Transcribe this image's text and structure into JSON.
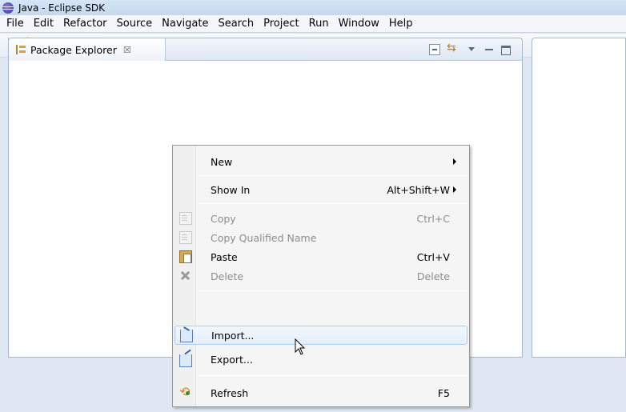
{
  "window": {
    "title": "Java - Eclipse SDK",
    "icon": "eclipse-icon"
  },
  "menubar": {
    "items": [
      "File",
      "Edit",
      "Refactor",
      "Source",
      "Navigate",
      "Search",
      "Project",
      "Run",
      "Window",
      "Help"
    ]
  },
  "toolbar": {
    "icons": [
      "new-wizard-icon",
      "save-icon",
      "save-all-icon",
      "print-icon",
      "download-icon",
      "build-icon",
      "task-check-icon",
      "new-java-project-icon",
      "new-junit-icon",
      "new-file-icon",
      "debug-icon",
      "run-icon",
      "external-tools-icon",
      "skip-breakpoints-icon",
      "new-package-icon",
      "new-class-icon",
      "open-type-icon"
    ]
  },
  "view": {
    "tab_label": "Package Explorer",
    "tab_close": "☒",
    "actions": [
      "collapse-all-icon",
      "link-with-editor-icon",
      "view-menu-icon",
      "minimize-icon",
      "maximize-icon"
    ]
  },
  "context_menu": {
    "items": [
      {
        "label": "New",
        "shortcut": "",
        "submenu": true,
        "enabled": true,
        "icon": ""
      },
      {
        "label": "Show In",
        "shortcut": "Alt+Shift+W",
        "submenu": true,
        "enabled": true,
        "icon": ""
      },
      {
        "label": "Copy",
        "shortcut": "Ctrl+C",
        "submenu": false,
        "enabled": false,
        "icon": "copy-icon"
      },
      {
        "label": "Copy Qualified Name",
        "shortcut": "",
        "submenu": false,
        "enabled": false,
        "icon": "copy-qualified-name-icon"
      },
      {
        "label": "Paste",
        "shortcut": "Ctrl+V",
        "submenu": false,
        "enabled": true,
        "icon": "paste-icon"
      },
      {
        "label": "Delete",
        "shortcut": "Delete",
        "submenu": false,
        "enabled": false,
        "icon": "delete-icon"
      },
      {
        "label": "Import...",
        "shortcut": "",
        "submenu": false,
        "enabled": true,
        "icon": "import-icon",
        "highlighted": true
      },
      {
        "label": "Export...",
        "shortcut": "",
        "submenu": false,
        "enabled": true,
        "icon": "export-icon"
      },
      {
        "label": "Refresh",
        "shortcut": "F5",
        "submenu": false,
        "enabled": true,
        "icon": "refresh-icon"
      }
    ]
  },
  "colors": {
    "accent_highlight": "#e3eefa",
    "highlight_border": "#aeccf0",
    "disabled_text": "#8d8d8d"
  }
}
